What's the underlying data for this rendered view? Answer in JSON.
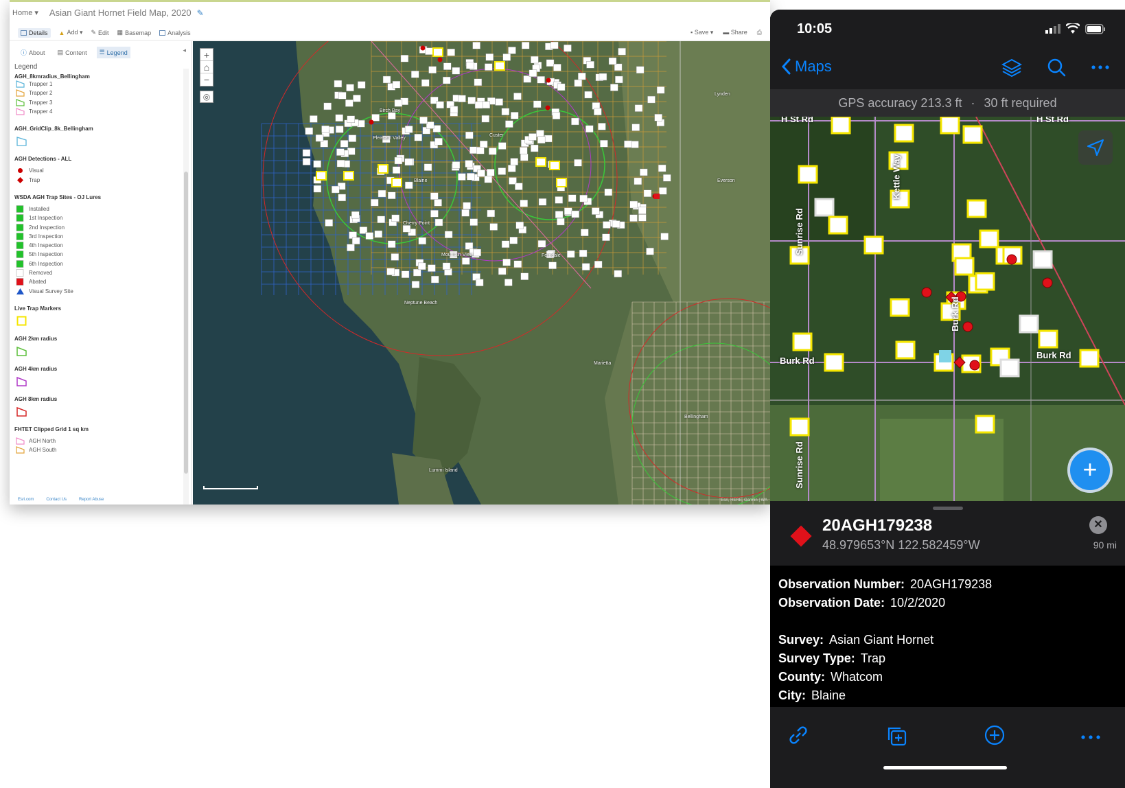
{
  "desktop": {
    "nav": {
      "home_label": "Home ▾",
      "map_title": "Asian Giant Hornet Field Map, 2020"
    },
    "toolbar": {
      "details": "Details",
      "add": "Add ▾",
      "edit": "Edit",
      "basemap": "Basemap",
      "analysis": "Analysis",
      "save": "Save ▾",
      "share": "Share"
    },
    "panel_tabs": {
      "about": "About",
      "content": "Content",
      "legend": "Legend"
    },
    "legend": {
      "title": "Legend",
      "layer1": "AGH_8kmradius_Bellingham",
      "trappers": [
        {
          "label": "Trapper 1",
          "color": "#59b3d9"
        },
        {
          "label": "Trapper 2",
          "color": "#e3a33a"
        },
        {
          "label": "Trapper 3",
          "color": "#5cbf3a"
        },
        {
          "label": "Trapper 4",
          "color": "#f08cc8"
        }
      ],
      "gridclip": "AGH_GridClip_8k_Bellingham",
      "detections_title": "AGH Detections - ALL",
      "detections": [
        {
          "label": "Visual",
          "color": "#cc0000"
        },
        {
          "label": "Trap",
          "color": "#cc0000"
        }
      ],
      "trapsites_title": "WSDA AGH Trap Sites - OJ Lures",
      "trapsites": [
        {
          "label": "Installed",
          "color": "#22c22b"
        },
        {
          "label": "1st Inspection",
          "color": "#22c22b"
        },
        {
          "label": "2nd Inspection",
          "color": "#22c22b"
        },
        {
          "label": "3rd Inspection",
          "color": "#22c22b"
        },
        {
          "label": "4th Inspection",
          "color": "#22c22b"
        },
        {
          "label": "5th Inspection",
          "color": "#22c22b"
        },
        {
          "label": "6th Inspection",
          "color": "#22c22b"
        },
        {
          "label": "Removed",
          "color": "#ffffff"
        },
        {
          "label": "Abated",
          "color": "#e0111a"
        },
        {
          "label": "Visual Survey Site",
          "color": "#1f57c8"
        }
      ],
      "livetrap_title": "Live Trap Markers",
      "radius2": "AGH 2km radius",
      "radius4": "AGH 4km radius",
      "radius8": "AGH 8km radius",
      "fhtet_title": "FHTET Clipped Grid 1 sq km",
      "fhtet": [
        {
          "label": "AGH North",
          "color": "#f08cc8"
        },
        {
          "label": "AGH South",
          "color": "#e3a33a"
        }
      ]
    },
    "footer_links": [
      "Esri.com",
      "Contact Us",
      "Report Abuse"
    ],
    "map_labels": {
      "birch_bay": "Birch Bay",
      "pleasant_valley": "Pleasant Valley",
      "blaine": "Blaine",
      "custer": "Custer",
      "cherry_point": "Cherry Point",
      "mountain_view": "Mountain View",
      "ferndale": "Ferndale",
      "neptune_beach": "Neptune Beach",
      "bellingham": "Bellingham",
      "lummi_island": "Lummi Island",
      "lynden": "Lynden",
      "everson": "Everson",
      "marietta": "Marietta"
    },
    "attribution": "Esri, HERE, Garmin | WA"
  },
  "phone": {
    "time": "10:05",
    "nav": {
      "back_label": "Maps"
    },
    "gps": {
      "accuracy": "GPS accuracy 213.3 ft",
      "separator": "·",
      "required": "30 ft required"
    },
    "roads": {
      "h_st_left": "H St Rd",
      "h_st_right": "H St Rd",
      "sunrise": "Sunrise Rd",
      "sunrise_bottom": "Sunrise Rd",
      "kettle": "Kettle Way",
      "burk_left": "Burk Rd",
      "burk_right": "Burk Rd",
      "burk_vertical": "Burk Rd"
    },
    "feature": {
      "id": "20AGH179238",
      "coords": "48.979653°N  122.582459°W",
      "distance": "90 mi",
      "marker_color": "#e0111a"
    },
    "attributes": [
      {
        "key": "Observation Number:",
        "value": "20AGH179238"
      },
      {
        "key": "Observation Date:",
        "value": "10/2/2020"
      },
      {
        "key": "Survey:",
        "value": "Asian Giant Hornet"
      },
      {
        "key": "Survey Type:",
        "value": "Trap"
      },
      {
        "key": "County:",
        "value": "Whatcom"
      },
      {
        "key": "City:",
        "value": "Blaine"
      }
    ],
    "colors": {
      "accent": "#0a84ff",
      "trap_outline": "#f5e600",
      "detection": "#e0111a"
    }
  }
}
